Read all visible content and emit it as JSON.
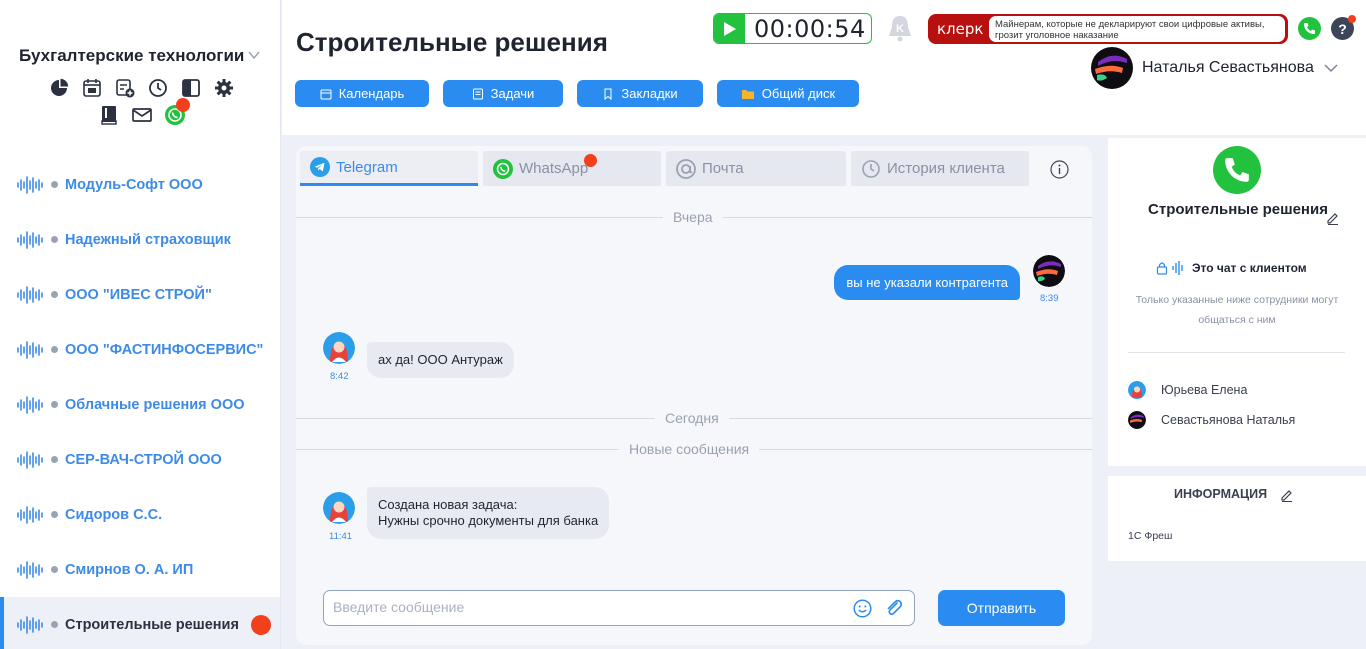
{
  "sidebar": {
    "org_name": "Бухгалтерские технологии",
    "tools_row1": [
      "pie-chart-icon",
      "calendar-icon",
      "task-add-icon",
      "clock-icon",
      "layout-icon",
      "gear-icon"
    ],
    "tools_row2": [
      "book-icon",
      "mail-icon",
      "whatsapp-icon"
    ],
    "clients": [
      {
        "name": "Модуль-Софт ООО",
        "active": false
      },
      {
        "name": "Надежный страховщик",
        "active": false
      },
      {
        "name": "ООО \"ИВЕС СТРОЙ\"",
        "active": false
      },
      {
        "name": "ООО \"ФАСТИНФОСЕРВИС\"",
        "active": false
      },
      {
        "name": "Облачные решения ООО",
        "active": false
      },
      {
        "name": "СЕР-ВАЧ-СТРОЙ ООО",
        "active": false
      },
      {
        "name": "Сидоров С.С.",
        "active": false
      },
      {
        "name": "Смирнов О. А. ИП",
        "active": false
      },
      {
        "name": "Строительные решения",
        "active": true
      }
    ]
  },
  "header": {
    "title": "Строительные решения",
    "buttons": [
      "Календарь",
      "Задачи",
      "Закладки",
      "Общий диск"
    ],
    "timer": "00:00:54",
    "news_logo": "клерк",
    "news_text": "Майнерам, которые не декларируют свои цифровые активы, грозит уголовное наказание",
    "user_name": "Наталья Севастьянова"
  },
  "chat": {
    "tabs": [
      {
        "label": "Telegram",
        "icon": "telegram-icon",
        "active": true
      },
      {
        "label": "WhatsApp",
        "icon": "whatsapp-icon",
        "active": false
      },
      {
        "label": "Почта",
        "icon": "at-icon",
        "active": false
      },
      {
        "label": "История клиента",
        "icon": "history-icon",
        "active": false
      }
    ],
    "day_yesterday": "Вчера",
    "msg_out_text": "вы не указали контрагента",
    "msg_out_time": "8:39",
    "msg_in1_text": "ах да! ООО Антураж",
    "msg_in1_time": "8:42",
    "day_today": "Сегодня",
    "new_messages": "Новые сообщения",
    "msg_in2_line1": "Создана новая задача:",
    "msg_in2_line2": "Нужны срочно документы для банка",
    "msg_in2_time": "11:41",
    "input_placeholder": "Введите сообщение",
    "send_label": "Отправить"
  },
  "right_panel": {
    "title": "Строительные решения",
    "chat_type": "Это чат с клиентом",
    "note": "Только указанные ниже сотрудники могут общаться с ним",
    "members": [
      "Юрьева Елена",
      "Севастьянова Наталья"
    ],
    "info_title": "ИНФОРМАЦИЯ",
    "info_value": "1С Фреш"
  },
  "colors": {
    "accent": "#2a8cf0",
    "green": "#23c23e",
    "alert": "#f2401c",
    "news_red": "#b80f0f"
  }
}
